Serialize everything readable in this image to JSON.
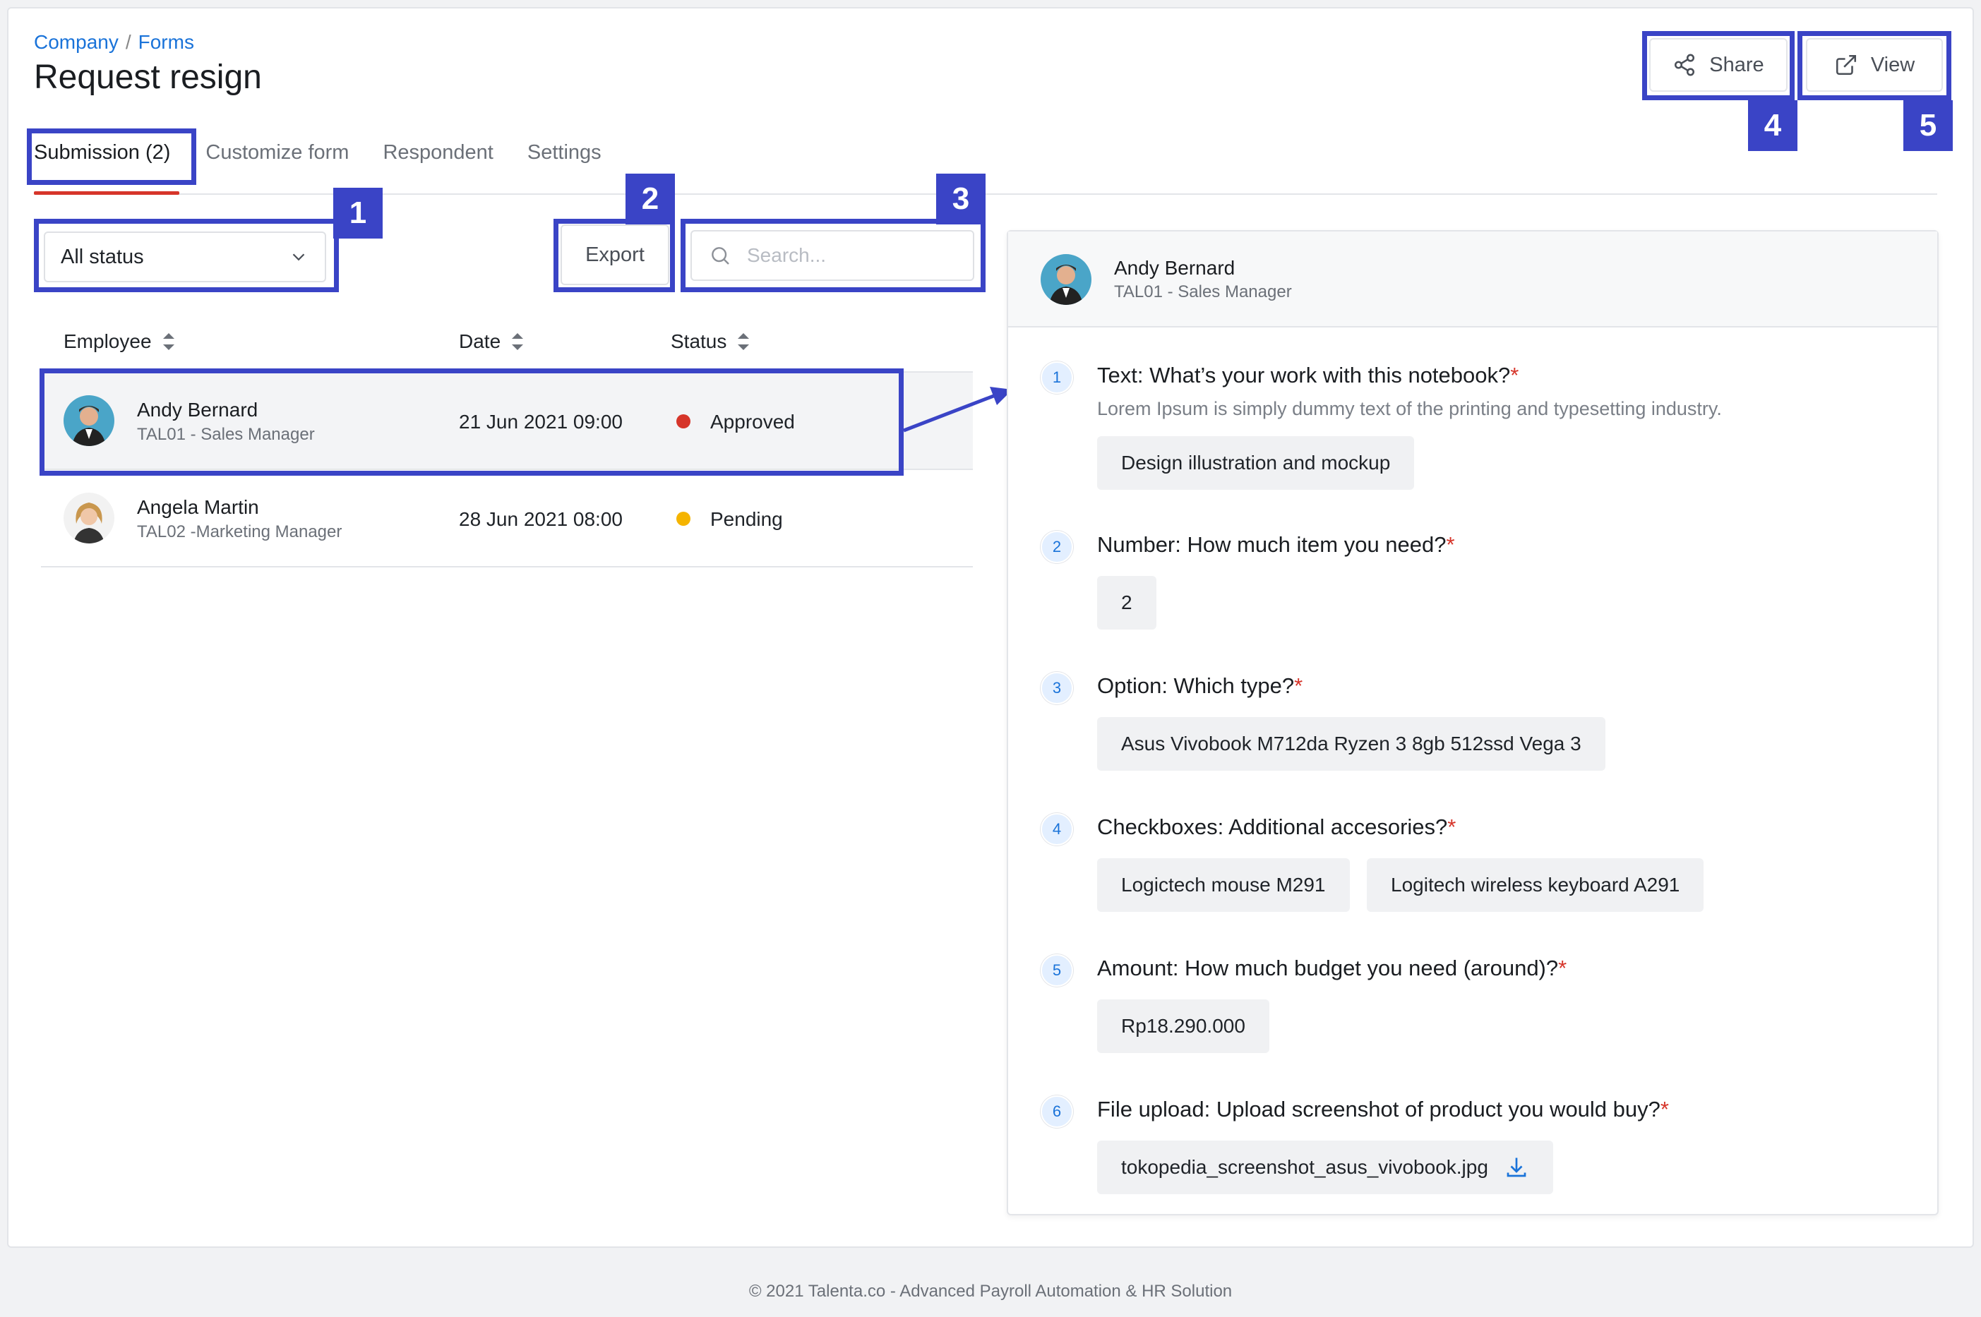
{
  "breadcrumb": {
    "company": "Company",
    "separator": "/",
    "forms": "Forms"
  },
  "page_title": "Request resign",
  "header_actions": {
    "share_label": "Share",
    "view_label": "View"
  },
  "tabs": [
    {
      "label": "Submission (2)",
      "active": true
    },
    {
      "label": "Customize form"
    },
    {
      "label": "Respondent"
    },
    {
      "label": "Settings"
    }
  ],
  "toolbar": {
    "status_filter": "All status",
    "export_label": "Export",
    "search_placeholder": "Search..."
  },
  "annotations": [
    "1",
    "2",
    "3",
    "4",
    "5"
  ],
  "table": {
    "columns": [
      "Employee",
      "Date",
      "Status"
    ],
    "rows": [
      {
        "name": "Andy Bernard",
        "sub": "TAL01 - Sales Manager",
        "date": "21 Jun 2021 09:00",
        "status": "Approved",
        "status_color": "#d6352a"
      },
      {
        "name": "Angela Martin",
        "sub": "TAL02 -Marketing Manager",
        "date": "28 Jun 2021 08:00",
        "status": "Pending",
        "status_color": "#f5b400"
      }
    ]
  },
  "detail": {
    "name": "Andy Bernard",
    "sub": "TAL01 - Sales Manager",
    "questions": [
      {
        "num": "1",
        "title": "Text: What’s your work with this notebook?",
        "desc": "Lorem Ipsum is simply dummy text of the printing and typesetting industry.",
        "answers": [
          "Design illustration and mockup"
        ]
      },
      {
        "num": "2",
        "title": "Number: How much item you need?",
        "answers": [
          "2"
        ]
      },
      {
        "num": "3",
        "title": "Option: Which type?",
        "answers": [
          "Asus Vivobook M712da Ryzen 3 8gb 512ssd Vega 3"
        ]
      },
      {
        "num": "4",
        "title": "Checkboxes: Additional accesories?",
        "answers": [
          "Logictech mouse M291",
          "Logitech wireless keyboard A291"
        ]
      },
      {
        "num": "5",
        "title": "Amount: How much budget you need (around)?",
        "answers": [
          "Rp18.290.000"
        ]
      },
      {
        "num": "6",
        "title": "File upload: Upload screenshot of product you would buy?",
        "answers": [
          "tokopedia_screenshot_asus_vivobook.jpg"
        ]
      }
    ],
    "required_mark": "*"
  },
  "footer": "© 2021 Talenta.co - Advanced Payroll Automation & HR Solution",
  "colors": {
    "accent": "#1a73d9",
    "annotation": "#3a44c6",
    "tab_underline": "#d6352a"
  },
  "icons": [
    "share-icon",
    "external-link-icon",
    "chevron-down-icon",
    "search-icon",
    "sort-icon",
    "download-icon"
  ]
}
